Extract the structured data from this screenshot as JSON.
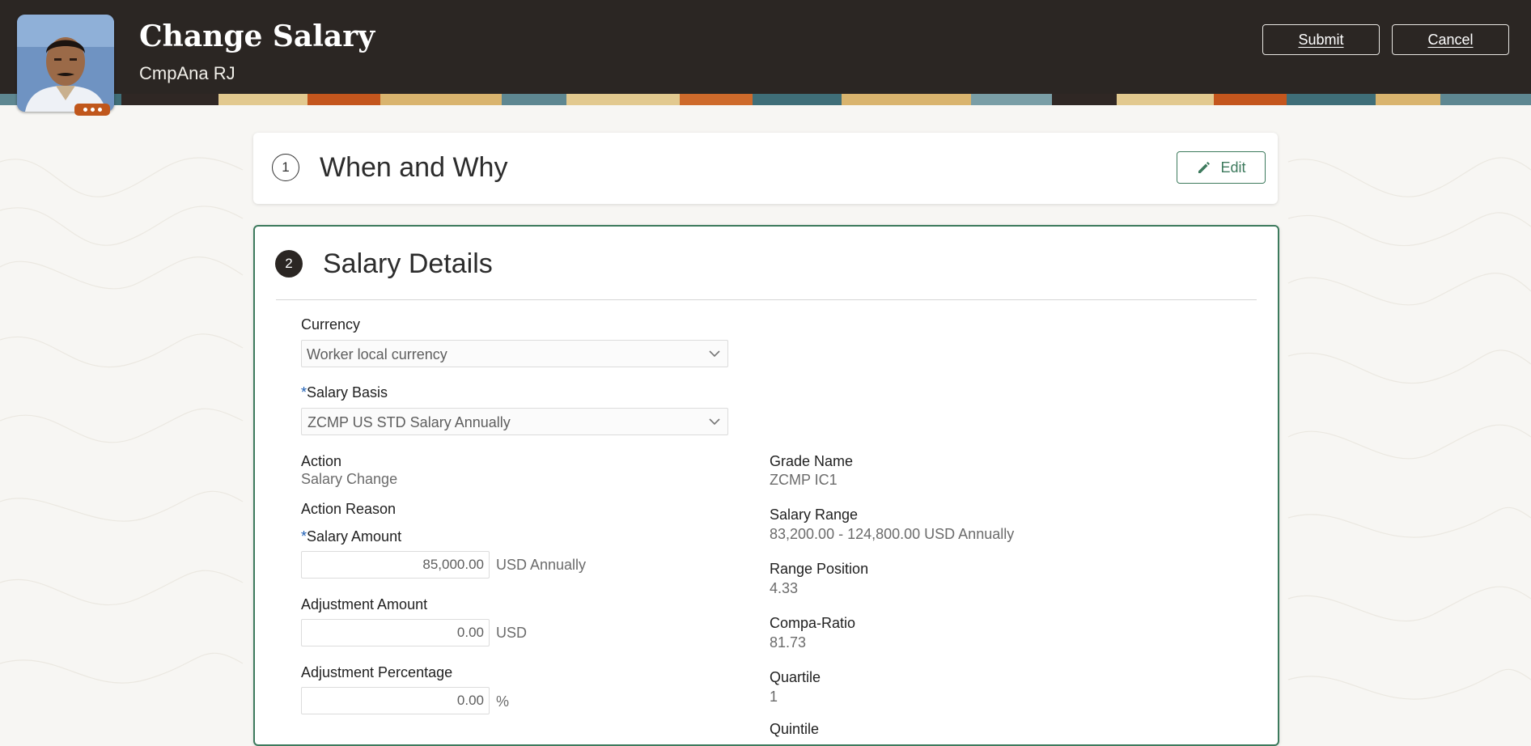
{
  "header": {
    "title": "Change Salary",
    "subtitle": "CmpAna RJ",
    "submit_label": "Submit",
    "cancel_label": "Cancel"
  },
  "colors": {
    "header_bg": "#2b2623",
    "accent_green": "#3d7a5d",
    "required_blue": "#1c5db3",
    "avatar_badge": "#c0571c"
  },
  "icons": {
    "more": "more-icon",
    "edit": "pencil-icon",
    "dropdown": "chevron-down-icon"
  },
  "section1": {
    "step": "1",
    "title": "When and Why",
    "edit_label": "Edit"
  },
  "section2": {
    "step": "2",
    "title": "Salary Details",
    "currency": {
      "label": "Currency",
      "value": "Worker local currency"
    },
    "salary_basis": {
      "required_mark": "*",
      "label": "Salary Basis",
      "value": "ZCMP US STD Salary Annually"
    },
    "action": {
      "label": "Action",
      "value": "Salary Change"
    },
    "action_reason": {
      "label": "Action Reason"
    },
    "salary_amount": {
      "required_mark": "*",
      "label": "Salary Amount",
      "value": "85,000.00",
      "unit": "USD Annually"
    },
    "adjustment_amount": {
      "label": "Adjustment Amount",
      "value": "0.00",
      "unit": "USD"
    },
    "adjustment_percentage": {
      "label": "Adjustment Percentage",
      "value": "0.00",
      "unit": "%"
    },
    "grade_name": {
      "label": "Grade Name",
      "value": "ZCMP IC1"
    },
    "salary_range": {
      "label": "Salary Range",
      "value": "83,200.00 - 124,800.00 USD Annually"
    },
    "range_position": {
      "label": "Range Position",
      "value": "4.33"
    },
    "compa_ratio": {
      "label": "Compa-Ratio",
      "value": "81.73"
    },
    "quartile": {
      "label": "Quartile",
      "value": "1"
    },
    "quintile": {
      "label": "Quintile"
    }
  }
}
